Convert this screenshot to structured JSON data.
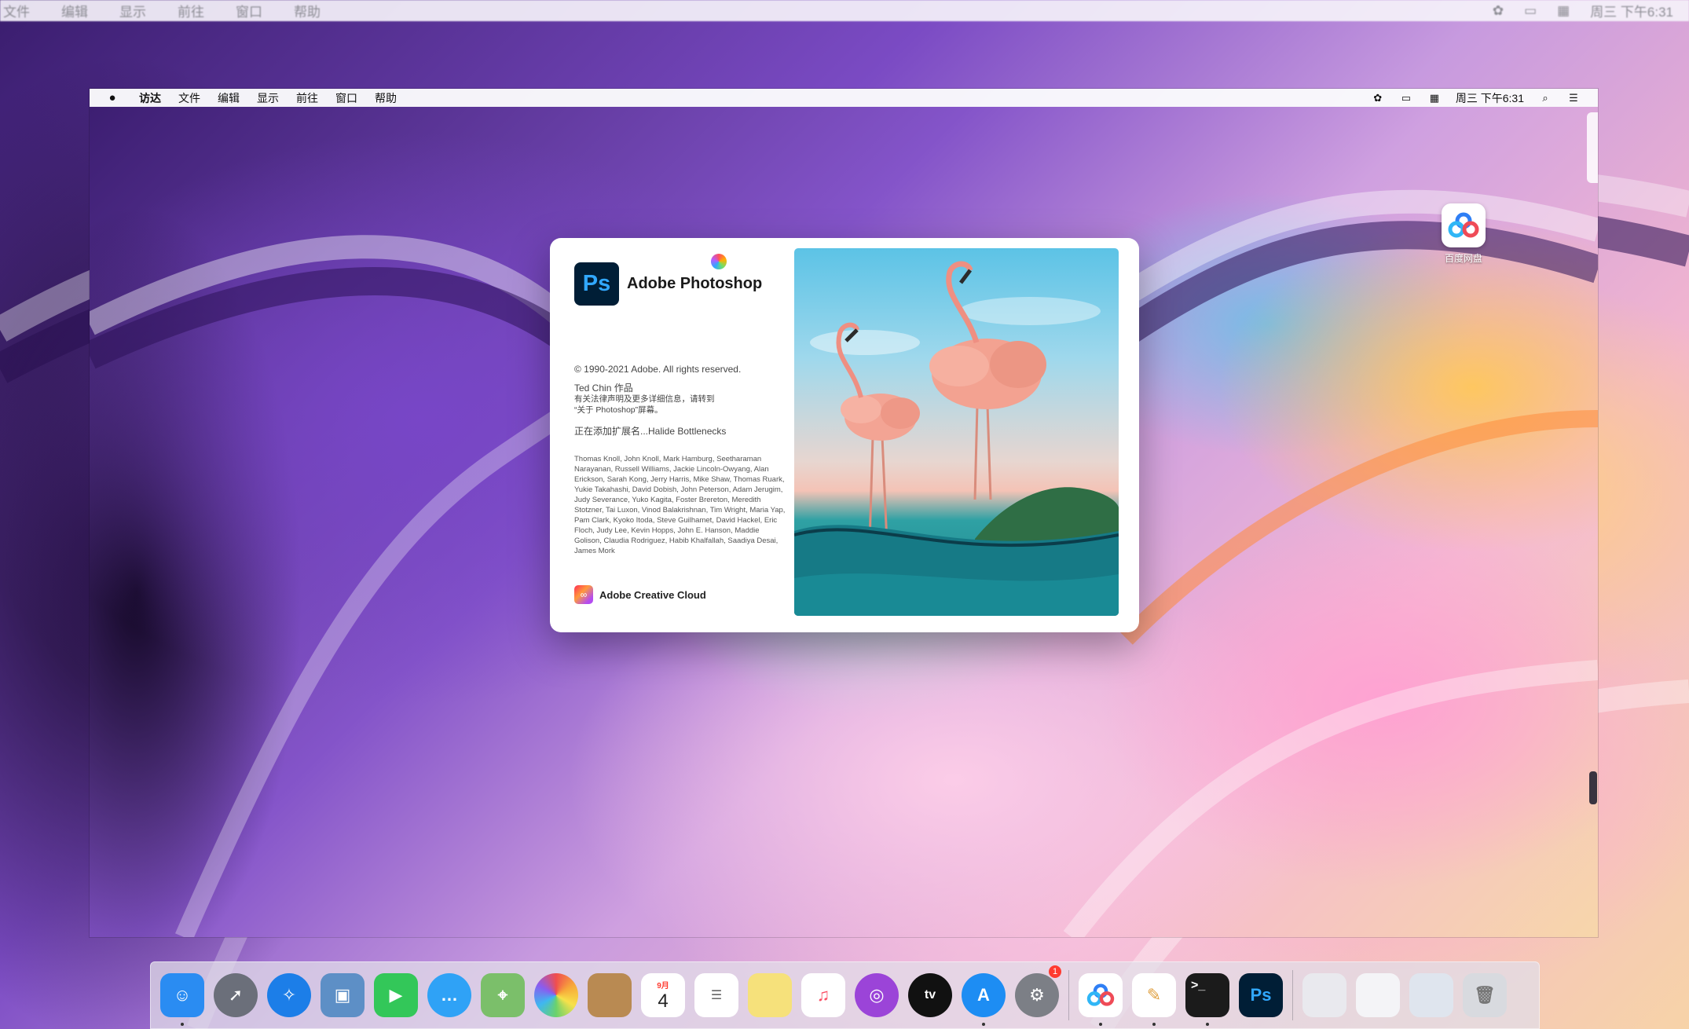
{
  "outer_menubar": {
    "items": [
      "文件",
      "编辑",
      "显示",
      "前往",
      "窗口",
      "帮助"
    ],
    "clock": "周三 下午6:31"
  },
  "inner_menubar": {
    "app_name": "访达",
    "items": [
      "文件",
      "编辑",
      "显示",
      "前往",
      "窗口",
      "帮助"
    ],
    "clock": "周三 下午6:31"
  },
  "desktop": {
    "icon_label": "百度网盘"
  },
  "splash": {
    "logo_text": "Ps",
    "app_title": "Adobe Photoshop",
    "copyright": "© 1990-2021 Adobe. All rights reserved.",
    "author": "Ted Chin 作品",
    "legal_line1": "有关法律声明及更多详细信息，请转到",
    "legal_line2": "“关于 Photoshop”屏幕。",
    "loading": "正在添加扩展名...Halide Bottlenecks",
    "credits": "Thomas Knoll, John Knoll, Mark Hamburg, Seetharaman Narayanan, Russell Williams, Jackie Lincoln-Owyang, Alan Erickson, Sarah Kong, Jerry Harris, Mike Shaw, Thomas Ruark, Yukie Takahashi, David Dobish, John Peterson, Adam Jerugim, Judy Severance, Yuko Kagita, Foster Brereton, Meredith Stotzner, Tai Luxon, Vinod Balakrishnan, Tim Wright, Maria Yap, Pam Clark, Kyoko Itoda, Steve Guilhamet, David Hackel, Eric Floch, Judy Lee, Kevin Hopps, John E. Hanson, Maddie Golison, Claudia Rodriguez, Habib Khalfallah, Saadiya Desai, James Mork",
    "footer": "Adobe Creative Cloud"
  },
  "dock": {
    "calendar_month": "9月",
    "calendar_day": "4",
    "settings_badge": "1",
    "tv_label": "tv",
    "photoshop_label": "Ps",
    "items": [
      {
        "name": "finder",
        "color": "#2a8cf2"
      },
      {
        "name": "launchpad",
        "color": "#6b6f7a"
      },
      {
        "name": "safari",
        "color": "#1c7ee8"
      },
      {
        "name": "preview",
        "color": "#5d8fc6"
      },
      {
        "name": "facetime",
        "color": "#33c759"
      },
      {
        "name": "messages",
        "color": "#2fa2f6"
      },
      {
        "name": "maps",
        "color": "#7bbf6a"
      },
      {
        "name": "photos",
        "color": "#f2a640"
      },
      {
        "name": "notes-book",
        "color": "#b98a52"
      },
      {
        "name": "calendar",
        "color": "#ffffff"
      },
      {
        "name": "reminders",
        "color": "#ffffff"
      },
      {
        "name": "stickies",
        "color": "#f6e17b"
      },
      {
        "name": "music",
        "color": "#fb4d63"
      },
      {
        "name": "podcasts",
        "color": "#9b44d8"
      },
      {
        "name": "apple-tv",
        "color": "#111111"
      },
      {
        "name": "app-store",
        "color": "#1d8df3"
      },
      {
        "name": "system-preferences",
        "color": "#7c7f86"
      },
      {
        "name": "baidu-netdisk",
        "color": "#ffffff"
      },
      {
        "name": "pencil-app",
        "color": "#ffffff"
      },
      {
        "name": "terminal",
        "color": "#1b1b1b"
      },
      {
        "name": "photoshop",
        "color": "#001e36"
      },
      {
        "name": "document-stack",
        "color": "#e9e9ee"
      },
      {
        "name": "document-preview",
        "color": "#f4f4f7"
      },
      {
        "name": "image-stack",
        "color": "#dfe5ee"
      },
      {
        "name": "trash",
        "color": "#d8dadf"
      }
    ]
  }
}
